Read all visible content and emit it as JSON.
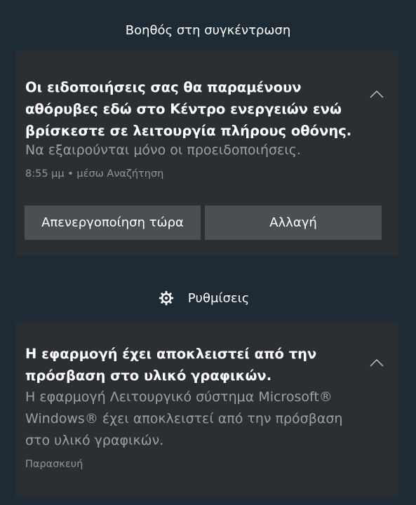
{
  "focus_assist": {
    "header": "Βοηθός στη συγκέντρωση",
    "notification": {
      "title": "Οι ειδοποιήσεις σας θα παραμένουν αθόρυβες εδώ στο Κέντρο ενεργειών ενώ βρίσκεστε σε λειτουργία πλήρους οθόνης.",
      "body": "Να εξαιρούνται μόνο οι προειδοποιήσεις.",
      "meta": "8:55 μμ • μέσω Αναζήτηση",
      "collapse_icon": "chevron-up-icon",
      "buttons": {
        "disable_now": "Απενεργοποίηση τώρα",
        "change": "Αλλαγή"
      }
    }
  },
  "settings": {
    "header": "Ρυθμίσεις",
    "icon": "gear-icon",
    "notification": {
      "title": "Η εφαρμογή έχει αποκλειστεί από την πρόσβαση στο υλικό γραφικών.",
      "body": "Η εφαρμογή Λειτουργικό σύστημα Microsoft® Windows® έχει αποκλειστεί από την πρόσβαση στο υλικό γραφικών.",
      "meta": "Παρασκευή",
      "collapse_icon": "chevron-up-icon"
    }
  },
  "colors": {
    "background": "#1f2b34",
    "card": "#2b2f33",
    "button": "#4c4f52",
    "secondary_text": "#9aa0a4"
  }
}
